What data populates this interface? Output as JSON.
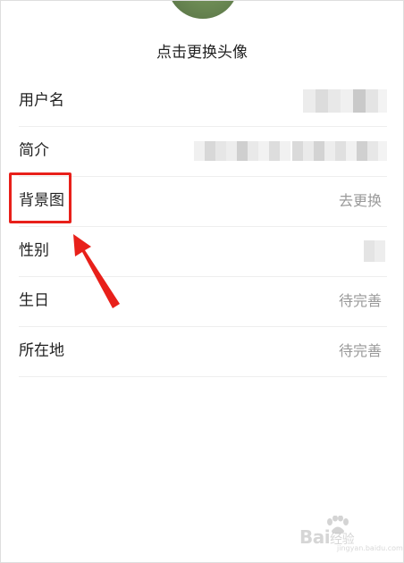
{
  "profile": {
    "avatar_caption": "点击更换头像"
  },
  "rows": [
    {
      "key": "username",
      "label": "用户名",
      "value": "",
      "blurred": true
    },
    {
      "key": "intro",
      "label": "简介",
      "value": "",
      "blurred": true
    },
    {
      "key": "background",
      "label": "背景图",
      "value": "去更换",
      "blurred": false
    },
    {
      "key": "gender",
      "label": "性别",
      "value": "",
      "blurred": true
    },
    {
      "key": "birthday",
      "label": "生日",
      "value": "待完善",
      "blurred": false
    },
    {
      "key": "location",
      "label": "所在地",
      "value": "待完善",
      "blurred": false
    }
  ],
  "annotation": {
    "highlight_color": "#e8201a",
    "highlighted_row": "background"
  },
  "watermark": {
    "brand": "Bai",
    "brand_suffix": "经验",
    "url": "jingyan.baidu.com"
  },
  "icons": {
    "watermark_logo": "baidu-paw-icon"
  }
}
